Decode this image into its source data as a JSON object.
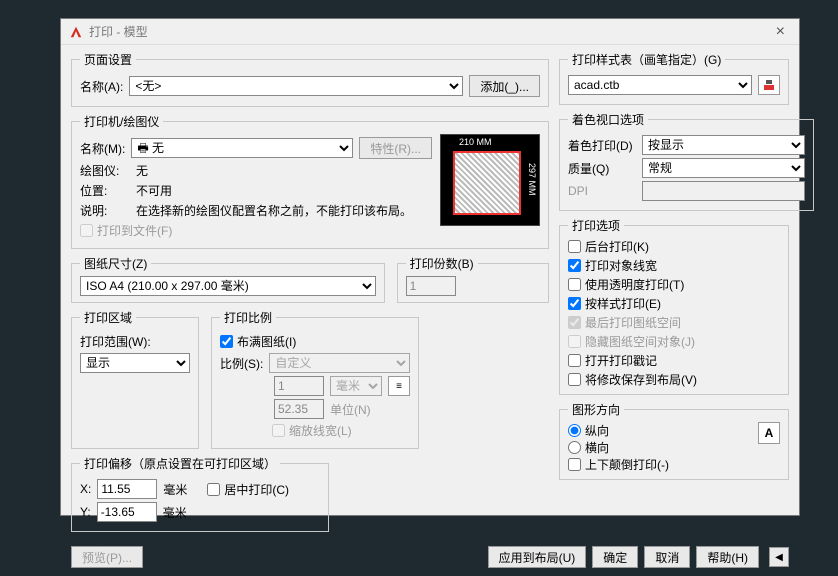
{
  "titlebar": {
    "title": "打印 - 模型",
    "close": "×"
  },
  "page_setup": {
    "legend": "页面设置",
    "name_label": "名称(A):",
    "name_value": "<无>",
    "add_btn": "添加(_)..."
  },
  "printer": {
    "legend": "打印机/绘图仪",
    "name_label": "名称(M):",
    "name_value": "🖶 无",
    "props_btn": "特性(R)...",
    "plotter_label": "绘图仪:",
    "plotter_value": "无",
    "loc_label": "位置:",
    "loc_value": "不可用",
    "desc_label": "说明:",
    "desc_value": "在选择新的绘图仪配置名称之前，不能打印该布局。",
    "to_file_label": "打印到文件(F)",
    "preview_top": "210 MM",
    "preview_right": "297 MM"
  },
  "paper": {
    "legend": "图纸尺寸(Z)",
    "value": "ISO A4 (210.00 x 297.00 毫米)"
  },
  "copies": {
    "legend": "打印份数(B)",
    "value": "1"
  },
  "area": {
    "legend": "打印区域",
    "label": "打印范围(W):",
    "value": "显示"
  },
  "scale": {
    "legend": "打印比例",
    "fit_label": "布满图纸(I)",
    "fit_checked": true,
    "ratio_label": "比例(S):",
    "ratio_value": "自定义",
    "unit_a": "1",
    "unit_a_sel": "毫米",
    "unit_sel_icon": "≡",
    "unit_b": "52.35",
    "unit_b_label": "单位(N)",
    "lw_label": "缩放线宽(L)"
  },
  "offset": {
    "legend": "打印偏移（原点设置在可打印区域）",
    "x_label": "X:",
    "x_value": "11.55",
    "y_label": "Y:",
    "y_value": "-13.65",
    "mm": "毫米",
    "center_label": "居中打印(C)"
  },
  "style": {
    "legend": "打印样式表（画笔指定）(G)",
    "value": "acad.ctb",
    "icon_title": "edit-style"
  },
  "viewport": {
    "legend": "着色视口选项",
    "shade_label": "着色打印(D)",
    "shade_value": "按显示",
    "quality_label": "质量(Q)",
    "quality_value": "常规",
    "dpi_label": "DPI",
    "dpi_value": ""
  },
  "options": {
    "legend": "打印选项",
    "items": [
      {
        "label": "后台打印(K)",
        "checked": false,
        "disabled": false
      },
      {
        "label": "打印对象线宽",
        "checked": true,
        "disabled": false
      },
      {
        "label": "使用透明度打印(T)",
        "checked": false,
        "disabled": false
      },
      {
        "label": "按样式打印(E)",
        "checked": true,
        "disabled": false
      },
      {
        "label": "最后打印图纸空间",
        "checked": true,
        "disabled": true
      },
      {
        "label": "隐藏图纸空间对象(J)",
        "checked": false,
        "disabled": true
      },
      {
        "label": "打开打印戳记",
        "checked": false,
        "disabled": false
      },
      {
        "label": "将修改保存到布局(V)",
        "checked": false,
        "disabled": false
      }
    ]
  },
  "orient": {
    "legend": "图形方向",
    "portrait": "纵向",
    "landscape": "横向",
    "upside_label": "上下颠倒打印(-)",
    "icon": "A"
  },
  "footer": {
    "preview": "预览(P)...",
    "apply": "应用到布局(U)",
    "ok": "确定",
    "cancel": "取消",
    "help": "帮助(H)",
    "expand": "◀"
  }
}
